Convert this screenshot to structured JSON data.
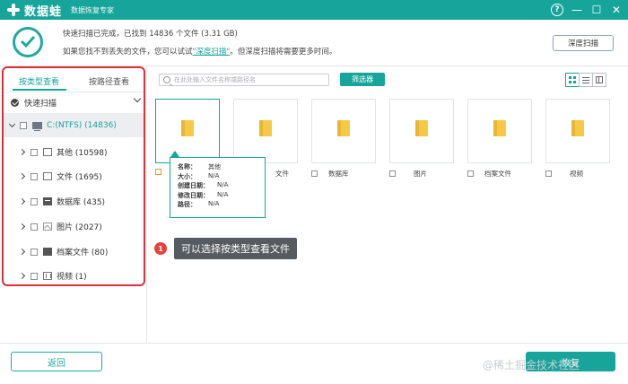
{
  "app": {
    "brand": "数据蛙",
    "tagline": "数据恢复专家",
    "help_glyph": "?",
    "minimize_glyph": "—",
    "maximize_glyph": "☐",
    "close_glyph": "✕"
  },
  "status": {
    "line1": "快速扫描已完成，已找到 14836 个文件 (3.31 GB)",
    "line2_before": "如果您找不到丢失的文件，您可以试试",
    "line2_link": "\"深度扫描\"",
    "line2_after": "。但深度扫描将需要更多时间。",
    "deep_scan_button": "深度扫描"
  },
  "sidebar": {
    "tab_type": "按类型查看",
    "tab_path": "按路径查看",
    "quick_scan": "快速扫描",
    "drive": "C:(NTFS) (14836)",
    "items": [
      {
        "label": "其他 (10598)"
      },
      {
        "label": "文件 (1695)"
      },
      {
        "label": "数据库 (435)"
      },
      {
        "label": "图片 (2027)"
      },
      {
        "label": "档案文件 (80)"
      },
      {
        "label": "视频 (1)"
      }
    ]
  },
  "toolbar": {
    "search_placeholder": "在此处输入文件名称或路径名",
    "filter_button": "筛选器"
  },
  "tiles": [
    {
      "label": ""
    },
    {
      "label": "文件"
    },
    {
      "label": "数据库"
    },
    {
      "label": "图片"
    },
    {
      "label": "档案文件"
    },
    {
      "label": "视频"
    }
  ],
  "tooltip": {
    "name_k": "名称：",
    "name_v": "其他",
    "size_k": "大小：",
    "size_v": "N/A",
    "created_k": "创建日期：",
    "created_v": "N/A",
    "modified_k": "修改日期：",
    "modified_v": "N/A",
    "path_k": "路径：",
    "path_v": "N/A"
  },
  "callout": {
    "number": "1",
    "text": "可以选择按类型查看文件"
  },
  "footer": {
    "back_button": "返回",
    "recover_button": "恢复",
    "watermark": "@稀土掘金技术社区"
  },
  "colors": {
    "brand": "#17a59b",
    "highlight_border": "#d9303a",
    "badge": "#e4413d"
  },
  "icons": {
    "logo": "plus-cross-icon",
    "scan_done": "check-circle-icon",
    "folder": "folder-icon"
  }
}
